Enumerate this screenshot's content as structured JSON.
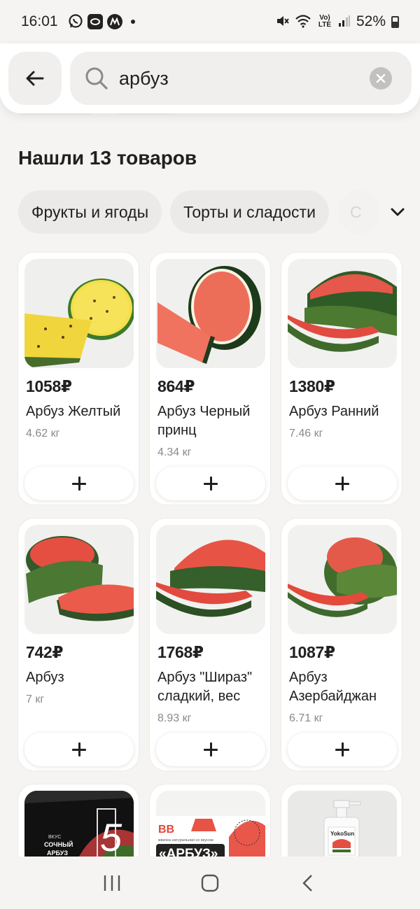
{
  "status_bar": {
    "time": "16:01",
    "battery": "52%",
    "network": "Vo) LTE"
  },
  "search": {
    "query": "арбуз"
  },
  "results": {
    "title": "Нашли 13 товаров"
  },
  "chips": [
    {
      "label": "Фрукты и ягоды"
    },
    {
      "label": "Торты и сладости"
    },
    {
      "label": "С"
    }
  ],
  "products": [
    {
      "price": "1058₽",
      "name": "Арбуз Желтый",
      "weight": "4.62 кг",
      "image": "yellow-watermelon"
    },
    {
      "price": "864₽",
      "name": "Арбуз Черный принц",
      "weight": "4.34 кг",
      "image": "black-prince-watermelon"
    },
    {
      "price": "1380₽",
      "name": "Арбуз Ранний",
      "weight": "7.46 кг",
      "image": "early-watermelon"
    },
    {
      "price": "742₽",
      "name": "Арбуз",
      "weight": "7 кг",
      "image": "watermelon"
    },
    {
      "price": "1768₽",
      "name": "Арбуз \"Шираз\" сладкий, вес",
      "weight": "8.93 кг",
      "image": "shiraz-watermelon"
    },
    {
      "price": "1087₽",
      "name": "Арбуз Азербайджан",
      "weight": "6.71 кг",
      "image": "azerbaijan-watermelon"
    }
  ],
  "partial_products": [
    {
      "image": "gum-pack",
      "text_top": "ВКУС",
      "text_mid": "СОЧНЫЙ",
      "text_bot": "АРБУЗ",
      "big": "5"
    },
    {
      "image": "juice-pack",
      "brand": "BB",
      "label": "«АРБУЗ»",
      "sub": "жвачка натуральная со вкусом"
    },
    {
      "image": "soap-bottle",
      "brand": "YokoSun"
    }
  ],
  "colors": {
    "background": "#f5f4f2",
    "card": "#ffffff",
    "chip": "#ebeae8",
    "text": "#21201f",
    "muted": "#8b8a88"
  }
}
